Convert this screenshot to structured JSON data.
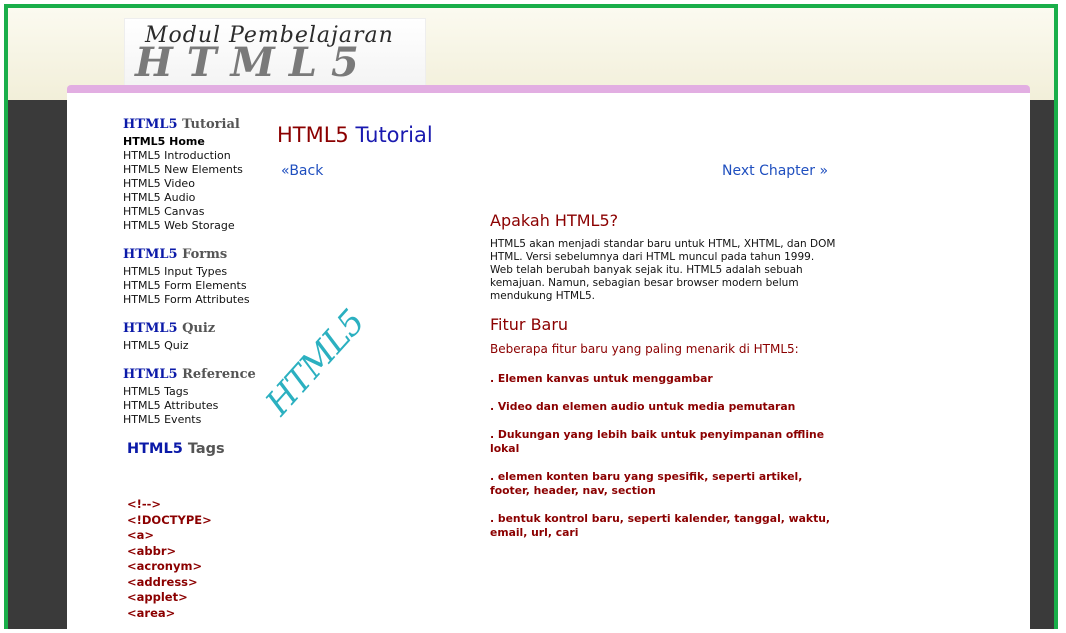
{
  "header": {
    "logo_top": "Modul Pembelajaran",
    "logo_big": "HTML5"
  },
  "sidebar": {
    "sections": [
      {
        "prefix": "HTML5",
        "title": "Tutorial",
        "items": [
          "HTML5 Home",
          "HTML5 Introduction",
          "HTML5 New Elements",
          "HTML5 Video",
          "HTML5 Audio",
          "HTML5 Canvas",
          "HTML5 Web Storage"
        ]
      },
      {
        "prefix": "HTML5",
        "title": "Forms",
        "items": [
          "HTML5 Input Types",
          "HTML5 Form Elements",
          "HTML5 Form Attributes"
        ]
      },
      {
        "prefix": "HTML5",
        "title": "Quiz",
        "items": [
          "HTML5 Quiz"
        ]
      },
      {
        "prefix": "HTML5",
        "title": "Reference",
        "items": [
          "HTML5 Tags",
          "HTML5 Attributes",
          "HTML5 Events"
        ]
      }
    ],
    "tags_heading": {
      "prefix": "HTML5",
      "title": "Tags"
    },
    "tags": [
      "<!-->",
      "<!DOCTYPE>",
      "<a>",
      "<abbr>",
      "<acronym>",
      "<address>",
      "<applet>",
      "<area>"
    ]
  },
  "main": {
    "title_prefix": "HTML5",
    "title": "Tutorial",
    "back_link": "«Back",
    "next_link": "Next Chapter »",
    "art_text": "HTML5",
    "section1_title": "Apakah HTML5?",
    "section1_body": "HTML5 akan menjadi standar baru untuk HTML, XHTML, dan DOM HTML. Versi sebelumnya dari HTML muncul pada tahun 1999. Web telah berubah banyak sejak itu. HTML5 adalah sebuah kemajuan. Namun, sebagian besar browser modern belum mendukung HTML5.",
    "section2_title": "Fitur Baru",
    "section2_intro": "Beberapa fitur baru yang paling menarik di HTML5:",
    "features": [
      ". Elemen kanvas untuk menggambar",
      ". Video dan elemen audio untuk media pemutaran",
      ". Dukungan yang lebih baik untuk penyimpanan offline lokal",
      ". elemen konten baru yang spesifik, seperti artikel, footer, header, nav, section",
      ". bentuk kontrol baru, seperti kalender, tanggal, waktu, email, url, cari"
    ]
  },
  "colors": {
    "frame_border": "#1aae4a",
    "side_background": "#3a3a3a",
    "accent_bar": "#e2aee2",
    "heading_red": "#8b0000",
    "link_blue": "#1f4fbf",
    "html5_blue": "#0b1aa8"
  }
}
